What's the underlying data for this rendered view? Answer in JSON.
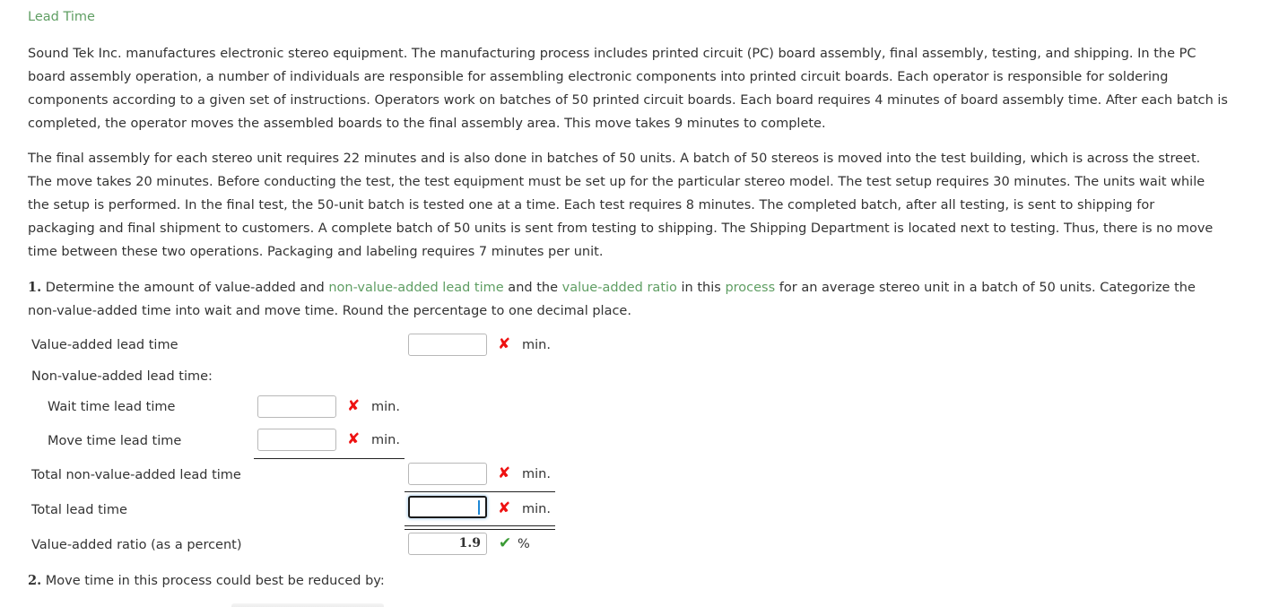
{
  "title": "Lead Time",
  "intro": {
    "p1_lines": [
      "Sound Tek Inc. manufactures electronic stereo equipment. The manufacturing process includes printed circuit (PC) board assembly, final assembly, testing, and shipping. In the PC",
      "board assembly operation, a number of individuals are responsible for assembling electronic components into printed circuit boards. Each operator is responsible for soldering",
      "components according to a given set of instructions. Operators work on batches of 50 printed circuit boards. Each board requires 4 minutes of board assembly time. After each batch is",
      "completed, the operator moves the assembled boards to the final assembly area. This move takes 9 minutes to complete."
    ],
    "p2_lines": [
      "The final assembly for each stereo unit requires 22 minutes and is also done in batches of 50 units. A batch of 50 stereos is moved into the test building, which is across the street.",
      "The move takes 20 minutes. Before conducting the test, the test equipment must be set up for the particular stereo model. The test setup requires 30 minutes. The units wait while",
      "the setup is performed. In the final test, the 50-unit batch is tested one at a time. Each test requires 8 minutes. The completed batch, after all testing, is sent to shipping for",
      "packaging and final shipment to customers. A complete batch of 50 units is sent from testing to shipping. The Shipping Department is located next to testing. Thus, there is no move",
      "time between these two operations. Packaging and labeling requires 7 minutes per unit."
    ]
  },
  "question1": {
    "number": "1.",
    "line1_a": " Determine the amount of value-added and ",
    "link1": "non-value-added lead time",
    "line1_b": " and the ",
    "link2": "value-added ratio",
    "line1_c": " in this ",
    "link3": "process",
    "line1_d": " for an average stereo unit in a batch of 50 units. Categorize the",
    "line2": "non-value-added time into wait and move time. Round the percentage to one decimal place."
  },
  "form": {
    "value_added": {
      "label": "Value-added lead time",
      "value": "",
      "status": "incorrect",
      "unit": "min."
    },
    "nva_heading": "Non-value-added lead time:",
    "wait_time": {
      "label": "Wait time lead time",
      "value": "",
      "status": "incorrect",
      "unit": "min."
    },
    "move_time": {
      "label": "Move time lead time",
      "value": "",
      "status": "incorrect",
      "unit": "min."
    },
    "total_nva": {
      "label": "Total non-value-added lead time",
      "value": "",
      "status": "incorrect",
      "unit": "min."
    },
    "total_lead": {
      "label": "Total lead time",
      "value": "",
      "status": "incorrect",
      "unit": "min.",
      "focused": true
    },
    "va_ratio": {
      "label": "Value-added ratio (as a percent)",
      "value": "1.9",
      "status": "correct",
      "unit": "%"
    }
  },
  "icons": {
    "incorrect": "✘",
    "correct": "✔"
  },
  "question2": {
    "number": "2.",
    "text": " Move time in this process could best be reduced by:"
  },
  "colors": {
    "link_green": "#5f9e63",
    "incorrect_red": "#ee1111",
    "correct_green": "#3a9a34",
    "caret_blue": "#1e88d6"
  }
}
